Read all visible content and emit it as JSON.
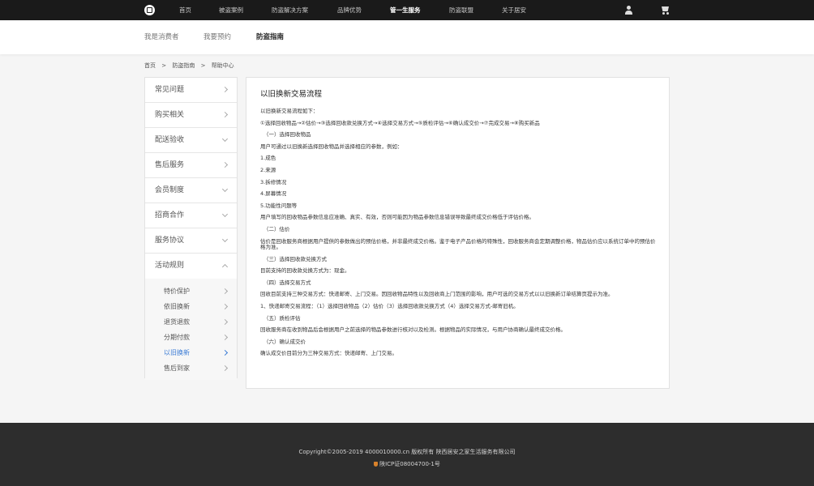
{
  "topnav": {
    "items": [
      "首页",
      "被盗案例",
      "防盗解决方案",
      "品牌优势",
      "管一生服务",
      "防盗联盟",
      "关于居安"
    ],
    "active": "管一生服务"
  },
  "subnav": {
    "items": [
      "我是消费者",
      "我要预约",
      "防盗指南"
    ],
    "active": "防盗指南"
  },
  "breadcrumb": [
    "首页",
    ">",
    "防盗指南",
    ">",
    "帮助中心"
  ],
  "sidebar": {
    "items": [
      "常见问题",
      "购买相关",
      "配送验收",
      "售后服务",
      "会员制度",
      "招商合作",
      "服务协议",
      "活动规则"
    ],
    "open_item": "活动规则",
    "sub_items": [
      "特价保护",
      "依旧换新",
      "退货退款",
      "分期付款",
      "以旧换新",
      "售后到家"
    ],
    "active_sub": "以旧换新"
  },
  "content": {
    "title": "以旧换新交易流程",
    "lines": [
      "以旧换新交易流程如下：",
      "①选择回收物品→②估价→③选择回收款兑换方式→④选择交易方式→⑤质检评估→⑥确认成交价→⑦完成交易→⑧购买新品",
      "（一）选择回收物品",
      "用户可通过以旧换新选择回收物品并选择相应的参数，例如：",
      "1.成色",
      "2.来源",
      "3.拆修情况",
      "4.屏幕情况",
      "5.功能性问题等",
      "用户填写的回收物品参数信息应准确、真实、有效，否则可能因为物品参数信息错误导致最终成交价格低于评估价格。",
      "（二）估价",
      "估价是回收服务商根据用户提供的参数做出的预估价格，并非最终成交价格。鉴于电子产品价格的特殊性，回收服务商会定期调整价格，物品估价应以系统订单中的预估价格为准。",
      "（三）选择回收款兑换方式",
      "目前支持的回收款兑换方式为：现金。",
      "（四）选择交易方式",
      "回收目前支持三种交易方式：快递邮寄、上门交易。因回收物品特性以及回收商上门范围的影响，用户可选的交易方式以以旧换新订单结算页提示为准。",
      "1、快递邮寄交易流程：（1）选择回收物品（2）估价（3）选择回收款兑换方式（4）选择交易方式-邮寄旧机。",
      "（五）质检评估",
      "回收服务商在收到物品后会根据用户之前选择的物品参数进行核对以及检测。根据物品的实际情况，与用户协商确认最终成交价格。",
      "（六）确认成交价",
      "确认成交价目前分为三种交易方式：快递邮寄、上门交易。"
    ]
  },
  "footer": {
    "copyright": "Copyright©2005-2019 4000010000.cn 版权所有 陕西居安之家生活服务有限公司",
    "icp": "陕ICP证08004700-1号"
  },
  "colors": {
    "topbar": "#1a1a1a",
    "accent": "#3a7bd5",
    "footer": "#2d2d2d",
    "page_bg": "#f5f5f5"
  },
  "icons": [
    "logo-icon",
    "user-icon",
    "cart-icon",
    "chevron-right-icon",
    "chevron-down-icon",
    "chevron-up-icon",
    "police-badge-icon"
  ]
}
